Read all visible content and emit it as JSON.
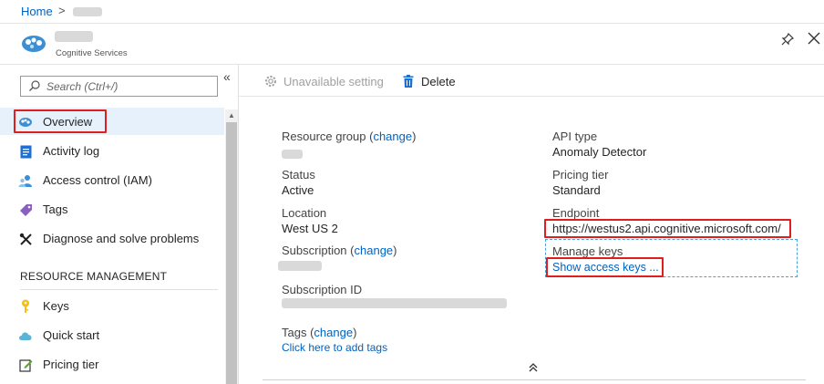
{
  "breadcrumb": {
    "home": "Home",
    "separator": ">"
  },
  "header": {
    "subtitle": "Cognitive Services"
  },
  "sidebar": {
    "search_placeholder": "Search (Ctrl+/)",
    "items": [
      {
        "label": "Overview",
        "icon": "cognitive-services-icon"
      },
      {
        "label": "Activity log",
        "icon": "activity-log-icon"
      },
      {
        "label": "Access control (IAM)",
        "icon": "users-icon"
      },
      {
        "label": "Tags",
        "icon": "tag-icon"
      },
      {
        "label": "Diagnose and solve problems",
        "icon": "wrench-icon"
      }
    ],
    "section_title": "RESOURCE MANAGEMENT",
    "section_items": [
      {
        "label": "Keys",
        "icon": "key-icon"
      },
      {
        "label": "Quick start",
        "icon": "cloud-icon"
      },
      {
        "label": "Pricing tier",
        "icon": "edit-icon"
      }
    ]
  },
  "toolbar": {
    "unavailable_label": "Unavailable setting",
    "delete_label": "Delete"
  },
  "overview": {
    "left": {
      "resource_group_label": "Resource group",
      "change": "change",
      "status_label": "Status",
      "status_value": "Active",
      "location_label": "Location",
      "location_value": "West US 2",
      "subscription_label": "Subscription",
      "subscription_id_label": "Subscription ID",
      "tags_label": "Tags",
      "tags_link": "Click here to add tags"
    },
    "right": {
      "api_type_label": "API type",
      "api_type_value": "Anomaly Detector",
      "pricing_tier_label": "Pricing tier",
      "pricing_tier_value": "Standard",
      "endpoint_label": "Endpoint",
      "endpoint_value": "https://westus2.api.cognitive.microsoft.com/",
      "manage_keys_label": "Manage keys",
      "show_keys_link": "Show access keys ..."
    }
  },
  "colors": {
    "link": "#0062c1",
    "highlight": "#e01e1e",
    "selected_bg": "#e7f1fb"
  }
}
